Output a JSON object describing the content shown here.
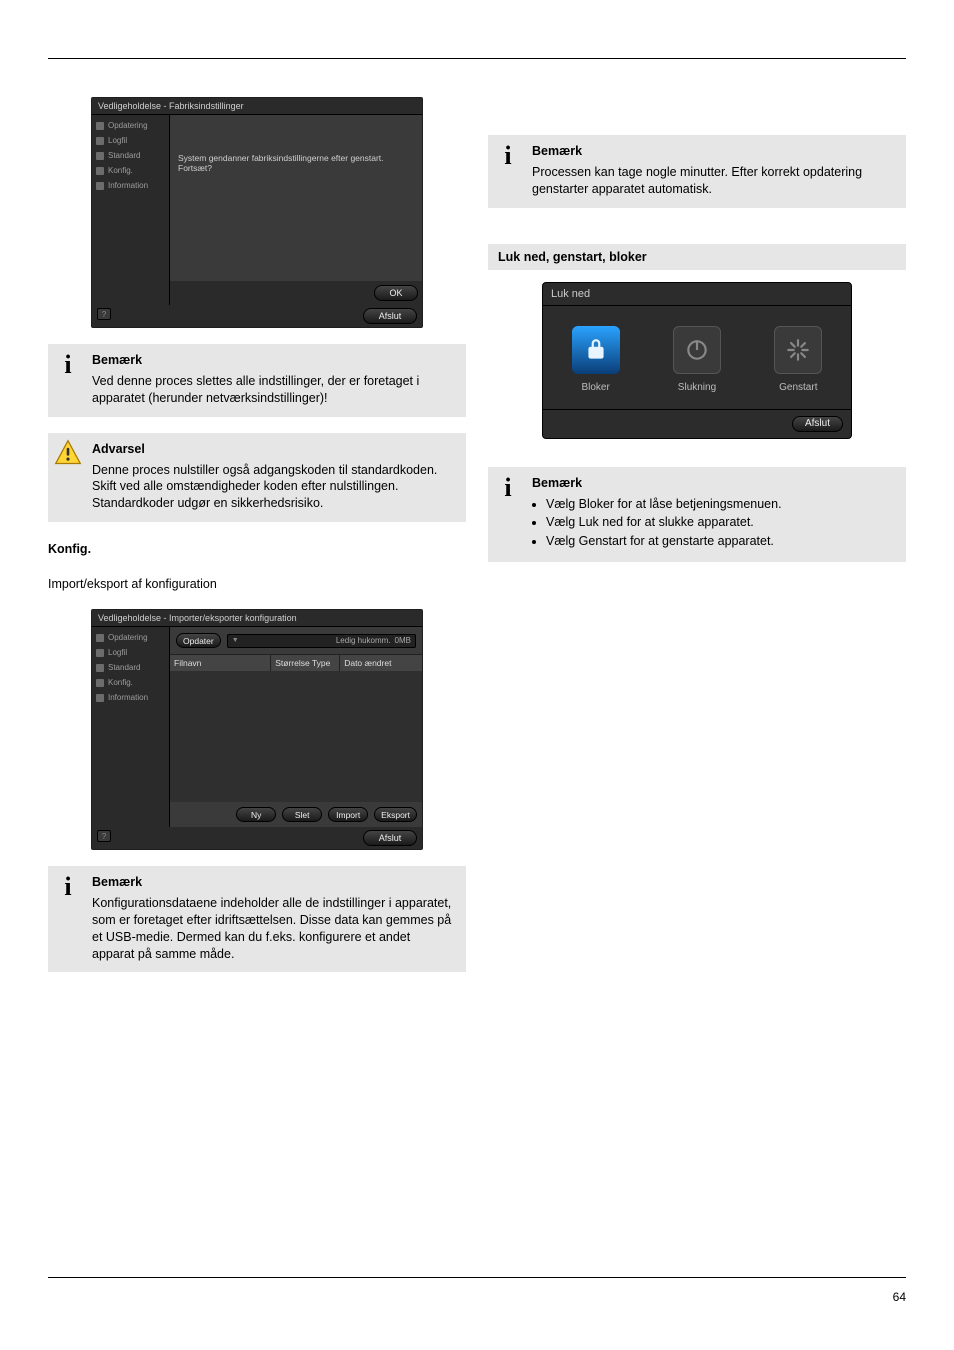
{
  "screenshot_factory": {
    "title": "Vedligeholdelse - Fabriksindstillinger",
    "nav": [
      "Opdatering",
      "Logfil",
      "Standard",
      "Konfig.",
      "Information"
    ],
    "message": "System gendanner fabriksindstillingerne efter genstart. Fortsæt?",
    "ok": "OK",
    "close": "Afslut",
    "help": "?"
  },
  "note_factory": {
    "heading": "Bemærk",
    "text": "Ved denne proces slettes alle indstillinger, der er foretaget i apparatet (herunder netværksindstillinger)!"
  },
  "warning": {
    "heading": "Advarsel",
    "text": "Denne proces nulstiller også adgangskoden til standardkoden. Skift ved alle omstændigheder koden efter nulstillingen. Standardkoder udgør en sikkerhedsrisiko."
  },
  "heading_config": "Konfig.",
  "heading_import_export": "Import/eksport af konfiguration",
  "screenshot_ie": {
    "title": "Vedligeholdelse - Importer/eksporter konfiguration",
    "nav": [
      "Opdatering",
      "Logfil",
      "Standard",
      "Konfig.",
      "Information"
    ],
    "refresh": "Opdater",
    "free_label": "Ledig hukomm.",
    "free_value": "0MB",
    "th_filnavn": "Filnavn",
    "th_size": "Størrelse Type",
    "th_date": "Dato ændret",
    "btn_ny": "Ny",
    "btn_slet": "Slet",
    "btn_import": "Import",
    "btn_eksport": "Eksport",
    "close": "Afslut",
    "help": "?"
  },
  "note_ie": {
    "heading": "Bemærk",
    "text": "Konfigurationsdataene indeholder alle de indstillinger i apparatet, som er foretaget efter idriftsættelsen. Disse data kan gemmes på et USB-medie. Dermed kan du f.eks. konfigurere et andet apparat på samme måde."
  },
  "note_right_top": {
    "heading": "Bemærk",
    "text": "Processen kan tage nogle minutter. Efter korrekt opdatering genstarter apparatet automatisk."
  },
  "heading_lukned": "Luk ned, genstart, bloker",
  "power_overlay": {
    "title": "Luk ned",
    "bloker": "Bloker",
    "slukning": "Slukning",
    "genstart": "Genstart",
    "afsl": "Afslut"
  },
  "note_power": {
    "heading": "Bemærk",
    "bullets": [
      "Vælg Bloker for at låse betjeningsmenuen.",
      "Vælg Luk ned for at slukke apparatet.",
      "Vælg Genstart for at genstarte apparatet."
    ]
  },
  "page_number": "64"
}
